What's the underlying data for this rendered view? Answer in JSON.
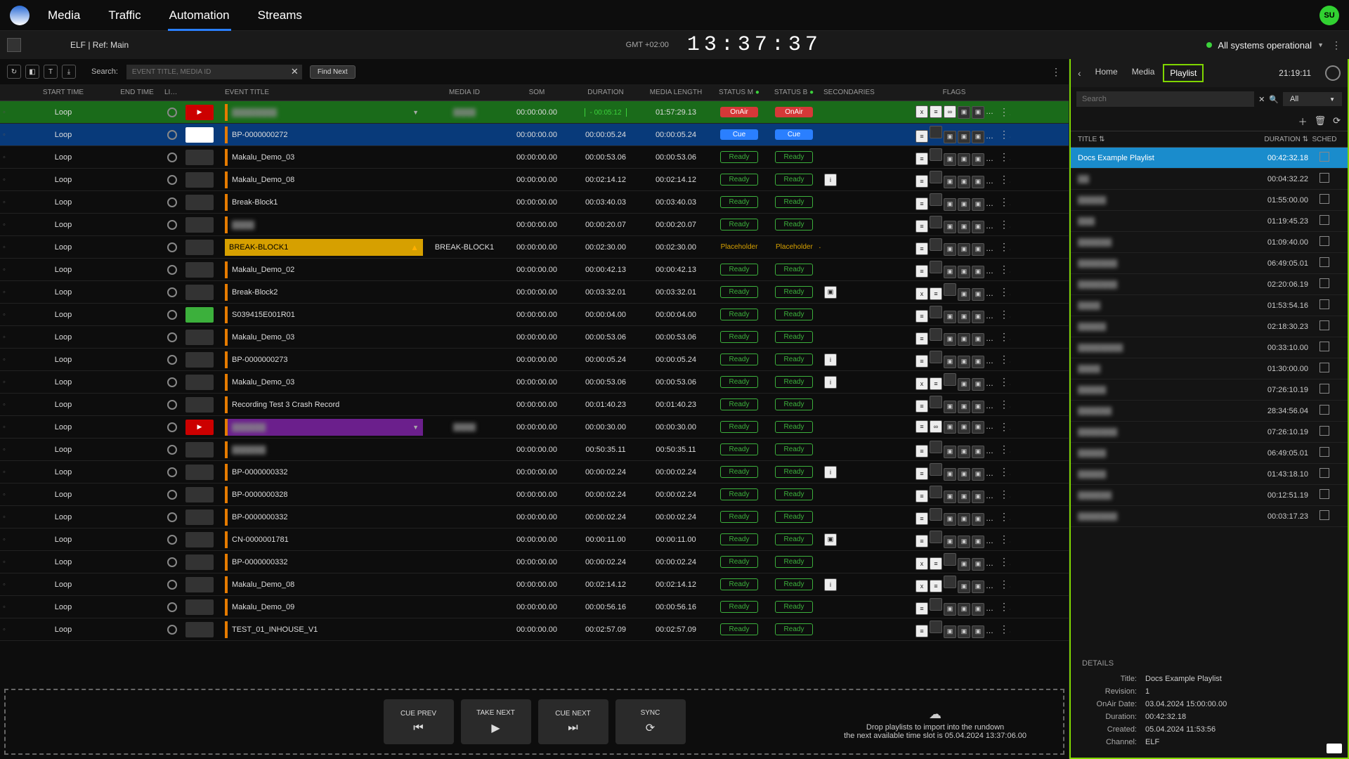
{
  "nav": {
    "items": [
      "Media",
      "Traffic",
      "Automation",
      "Streams"
    ],
    "active": 2,
    "avatar": "SU"
  },
  "secondbar": {
    "channel": "ELF | Ref: Main",
    "gmt": "GMT +02:00",
    "clock": "13:37:37",
    "status": "All systems operational"
  },
  "search": {
    "label": "Search:",
    "placeholder": "EVENT TITLE, MEDIA ID",
    "find_next": "Find Next"
  },
  "columns": {
    "start": "START TIME",
    "end": "END TIME",
    "link": "LINK",
    "title": "EVENT TITLE",
    "media": "MEDIA ID",
    "som": "SOM",
    "dur": "DURATION",
    "mlen": "MEDIA LENGTH",
    "stm": "STATUS M",
    "stb": "STATUS B",
    "sec": "SECONDARIES",
    "flags": "FLAGS"
  },
  "countdown": "- 00:05:12",
  "rows": [
    {
      "variant": "green",
      "start": "Loop",
      "thumb": "play",
      "title": "▓▓▓▓▓▓▓▓",
      "blurTitle": true,
      "dd": true,
      "media": "▓▓▓▓",
      "blurMedia": true,
      "som": "00:00:00.00",
      "dur": "cd",
      "mlen": "01:57:29.13",
      "stm": "OnAir",
      "stb": "OnAir",
      "flags": [
        "x",
        "≡",
        "∞",
        "▣",
        "▣",
        "▣",
        "▤"
      ]
    },
    {
      "variant": "blue",
      "start": "Loop",
      "thumb": "pause",
      "title": "BP-0000000272",
      "som": "00:00:00.00",
      "dur": "00:00:05.24",
      "mlen": "00:00:05.24",
      "stm": "Cue",
      "stb": "Cue",
      "flags": [
        "≡",
        "",
        "▣",
        "▣",
        "▣",
        "▤"
      ]
    },
    {
      "start": "Loop",
      "title": "Makalu_Demo_03",
      "som": "00:00:00.00",
      "dur": "00:00:53.06",
      "mlen": "00:00:53.06",
      "stm": "Ready",
      "stb": "Ready",
      "flags": [
        "≡",
        "",
        "▣",
        "▣",
        "▣",
        "▤"
      ]
    },
    {
      "start": "Loop",
      "title": "Makalu_Demo_08",
      "som": "00:00:00.00",
      "dur": "00:02:14.12",
      "mlen": "00:02:14.12",
      "stm": "Ready",
      "stb": "Ready",
      "sec": [
        "i"
      ],
      "flags": [
        "≡",
        "",
        "▣",
        "▣",
        "▣",
        "▤"
      ]
    },
    {
      "start": "Loop",
      "title": "Break-Block1",
      "som": "00:00:00.00",
      "dur": "00:03:40.03",
      "mlen": "00:03:40.03",
      "stm": "Ready",
      "stb": "Ready",
      "flags": [
        "≡",
        "",
        "▣",
        "▣",
        "▣",
        "▤"
      ]
    },
    {
      "start": "Loop",
      "title": "▓▓▓▓",
      "blurTitle": true,
      "som": "00:00:00.00",
      "dur": "00:00:20.07",
      "mlen": "00:00:20.07",
      "stm": "Ready",
      "stb": "Ready",
      "flags": [
        "≡",
        "",
        "▣",
        "▣",
        "▣",
        "▤"
      ]
    },
    {
      "variant": "yellow",
      "start": "Loop",
      "title": "BREAK-BLOCK1",
      "warn": true,
      "media": "BREAK-BLOCK1",
      "som": "00:00:00.00",
      "dur": "00:02:30.00",
      "mlen": "00:02:30.00",
      "stm": "Placeholder",
      "stb": "Placeholder",
      "flags": [
        "≡",
        "",
        "▣",
        "▣",
        "▣",
        "▤"
      ]
    },
    {
      "start": "Loop",
      "title": "Makalu_Demo_02",
      "som": "00:00:00.00",
      "dur": "00:00:42.13",
      "mlen": "00:00:42.13",
      "stm": "Ready",
      "stb": "Ready",
      "flags": [
        "≡",
        "",
        "▣",
        "▣",
        "▣",
        "▤"
      ]
    },
    {
      "start": "Loop",
      "title": "Break-Block2",
      "som": "00:00:00.00",
      "dur": "00:03:32.01",
      "mlen": "00:03:32.01",
      "stm": "Ready",
      "stb": "Ready",
      "sec": [
        "▣"
      ],
      "flags": [
        "x",
        "≡",
        "",
        "▣",
        "▣",
        "▣",
        "▤"
      ]
    },
    {
      "start": "Loop",
      "thumb": "green-th",
      "title": "S039415E001R01",
      "som": "00:00:00.00",
      "dur": "00:00:04.00",
      "mlen": "00:00:04.00",
      "stm": "Ready",
      "stb": "Ready",
      "flags": [
        "≡",
        "",
        "▣",
        "▣",
        "▣",
        "▤"
      ]
    },
    {
      "start": "Loop",
      "title": "Makalu_Demo_03",
      "som": "00:00:00.00",
      "dur": "00:00:53.06",
      "mlen": "00:00:53.06",
      "stm": "Ready",
      "stb": "Ready",
      "flags": [
        "≡",
        "",
        "▣",
        "▣",
        "▣",
        "▤"
      ]
    },
    {
      "start": "Loop",
      "title": "BP-0000000273",
      "som": "00:00:00.00",
      "dur": "00:00:05.24",
      "mlen": "00:00:05.24",
      "stm": "Ready",
      "stb": "Ready",
      "sec": [
        "i"
      ],
      "flags": [
        "≡",
        "",
        "▣",
        "▣",
        "▣",
        "▤"
      ]
    },
    {
      "start": "Loop",
      "title": "Makalu_Demo_03",
      "som": "00:00:00.00",
      "dur": "00:00:53.06",
      "mlen": "00:00:53.06",
      "stm": "Ready",
      "stb": "Ready",
      "sec": [
        "i"
      ],
      "flags": [
        "x",
        "≡",
        "",
        "▣",
        "▣",
        "▣",
        "▤"
      ]
    },
    {
      "start": "Loop",
      "title": "Recording Test 3 Crash Record",
      "som": "00:00:00.00",
      "dur": "00:01:40.23",
      "mlen": "00:01:40.23",
      "stm": "Ready",
      "stb": "Ready",
      "flags": [
        "≡",
        "",
        "▣",
        "▣",
        "▣",
        "▤"
      ]
    },
    {
      "variant": "purple",
      "start": "Loop",
      "thumb": "play",
      "title": "▓▓▓▓▓▓",
      "blurTitle": true,
      "dd": true,
      "media": "▓▓▓▓",
      "blurMedia": true,
      "som": "00:00:00.00",
      "dur": "00:00:30.00",
      "mlen": "00:00:30.00",
      "stm": "Ready",
      "stb": "Ready",
      "flags": [
        "≡",
        "∞",
        "▣",
        "▣",
        "▣",
        "▤"
      ]
    },
    {
      "start": "Loop",
      "title": "▓▓▓▓▓▓",
      "blurTitle": true,
      "som": "00:00:00.00",
      "dur": "00:50:35.11",
      "mlen": "00:50:35.11",
      "stm": "Ready",
      "stb": "Ready",
      "flags": [
        "≡",
        "",
        "▣",
        "▣",
        "▣",
        "▤"
      ]
    },
    {
      "start": "Loop",
      "title": "BP-0000000332",
      "som": "00:00:00.00",
      "dur": "00:00:02.24",
      "mlen": "00:00:02.24",
      "stm": "Ready",
      "stb": "Ready",
      "sec": [
        "i"
      ],
      "flags": [
        "≡",
        "",
        "▣",
        "▣",
        "▣",
        "▤"
      ]
    },
    {
      "start": "Loop",
      "title": "BP-0000000328",
      "som": "00:00:00.00",
      "dur": "00:00:02.24",
      "mlen": "00:00:02.24",
      "stm": "Ready",
      "stb": "Ready",
      "flags": [
        "≡",
        "",
        "▣",
        "▣",
        "▣",
        "▤"
      ]
    },
    {
      "start": "Loop",
      "title": "BP-0000000332",
      "som": "00:00:00.00",
      "dur": "00:00:02.24",
      "mlen": "00:00:02.24",
      "stm": "Ready",
      "stb": "Ready",
      "flags": [
        "≡",
        "",
        "▣",
        "▣",
        "▣",
        "▤"
      ]
    },
    {
      "start": "Loop",
      "title": "CN-0000001781",
      "som": "00:00:00.00",
      "dur": "00:00:11.00",
      "mlen": "00:00:11.00",
      "stm": "Ready",
      "stb": "Ready",
      "sec": [
        "▣"
      ],
      "flags": [
        "≡",
        "",
        "▣",
        "▣",
        "▣",
        "▤"
      ]
    },
    {
      "start": "Loop",
      "title": "BP-0000000332",
      "som": "00:00:00.00",
      "dur": "00:00:02.24",
      "mlen": "00:00:02.24",
      "stm": "Ready",
      "stb": "Ready",
      "flags": [
        "x",
        "≡",
        "",
        "▣",
        "▣",
        "▣",
        "▤"
      ]
    },
    {
      "start": "Loop",
      "title": "Makalu_Demo_08",
      "som": "00:00:00.00",
      "dur": "00:02:14.12",
      "mlen": "00:02:14.12",
      "stm": "Ready",
      "stb": "Ready",
      "sec": [
        "i"
      ],
      "flags": [
        "x",
        "≡",
        "",
        "▣",
        "▣",
        "▣",
        "▤"
      ]
    },
    {
      "start": "Loop",
      "title": "Makalu_Demo_09",
      "som": "00:00:00.00",
      "dur": "00:00:56.16",
      "mlen": "00:00:56.16",
      "stm": "Ready",
      "stb": "Ready",
      "flags": [
        "≡",
        "",
        "▣",
        "▣",
        "▣",
        "▤"
      ]
    },
    {
      "start": "Loop",
      "title": "TEST_01_INHOUSE_V1",
      "som": "00:00:00.00",
      "dur": "00:02:57.09",
      "mlen": "00:02:57.09",
      "stm": "Ready",
      "stb": "Ready",
      "flags": [
        "≡",
        "",
        "▣",
        "▣",
        "▣",
        "▤"
      ]
    }
  ],
  "drop": {
    "line1": "Drop playlists to import into the rundown",
    "line2": "the next available time slot is 05.04.2024 13:37:06.00",
    "buttons": [
      {
        "label": "CUE PREV",
        "glyph": "⏮"
      },
      {
        "label": "TAKE NEXT",
        "glyph": "▶"
      },
      {
        "label": "CUE NEXT",
        "glyph": "⏭"
      },
      {
        "label": "SYNC",
        "glyph": "⟳"
      }
    ]
  },
  "right": {
    "tabs": [
      "Home",
      "Media",
      "Playlist"
    ],
    "active": 2,
    "clock": "21:19:11",
    "search_placeholder": "Search",
    "filter": "All",
    "head": {
      "title": "TITLE",
      "dur": "DURATION",
      "sched": "SCHED"
    },
    "rows": [
      {
        "t": "Docs Example Playlist",
        "d": "00:42:32.18",
        "sel": true
      },
      {
        "t": "▓▓",
        "d": "00:04:32.22",
        "blur": true
      },
      {
        "t": "▓▓▓▓▓",
        "d": "01:55:00.00",
        "blur": true
      },
      {
        "t": "▓▓▓",
        "d": "01:19:45.23",
        "blur": true
      },
      {
        "t": "▓▓▓▓▓▓",
        "d": "01:09:40.00",
        "blur": true
      },
      {
        "t": "▓▓▓▓▓▓▓",
        "d": "06:49:05.01",
        "blur": true
      },
      {
        "t": "▓▓▓▓▓▓▓",
        "d": "02:20:06.19",
        "blur": true
      },
      {
        "t": "▓▓▓▓",
        "d": "01:53:54.16",
        "blur": true
      },
      {
        "t": "▓▓▓▓▓",
        "d": "02:18:30.23",
        "blur": true
      },
      {
        "t": "▓▓▓▓▓▓▓▓",
        "d": "00:33:10.00",
        "blur": true
      },
      {
        "t": "▓▓▓▓",
        "d": "01:30:00.00",
        "blur": true
      },
      {
        "t": "▓▓▓▓▓",
        "d": "07:26:10.19",
        "blur": true
      },
      {
        "t": "▓▓▓▓▓▓",
        "d": "28:34:56.04",
        "blur": true
      },
      {
        "t": "▓▓▓▓▓▓▓",
        "d": "07:26:10.19",
        "blur": true
      },
      {
        "t": "▓▓▓▓▓",
        "d": "06:49:05.01",
        "blur": true
      },
      {
        "t": "▓▓▓▓▓",
        "d": "01:43:18.10",
        "blur": true
      },
      {
        "t": "▓▓▓▓▓▓",
        "d": "00:12:51.19",
        "blur": true
      },
      {
        "t": "▓▓▓▓▓▓▓",
        "d": "00:03:17.23",
        "blur": true
      }
    ],
    "details": {
      "heading": "DETAILS",
      "Title": "Docs Example Playlist",
      "Revision": "1",
      "OnAir Date": "03.04.2024 15:00:00.00",
      "Duration": "00:42:32.18",
      "Created": "05.04.2024 11:53:56",
      "Channel": "ELF"
    }
  }
}
